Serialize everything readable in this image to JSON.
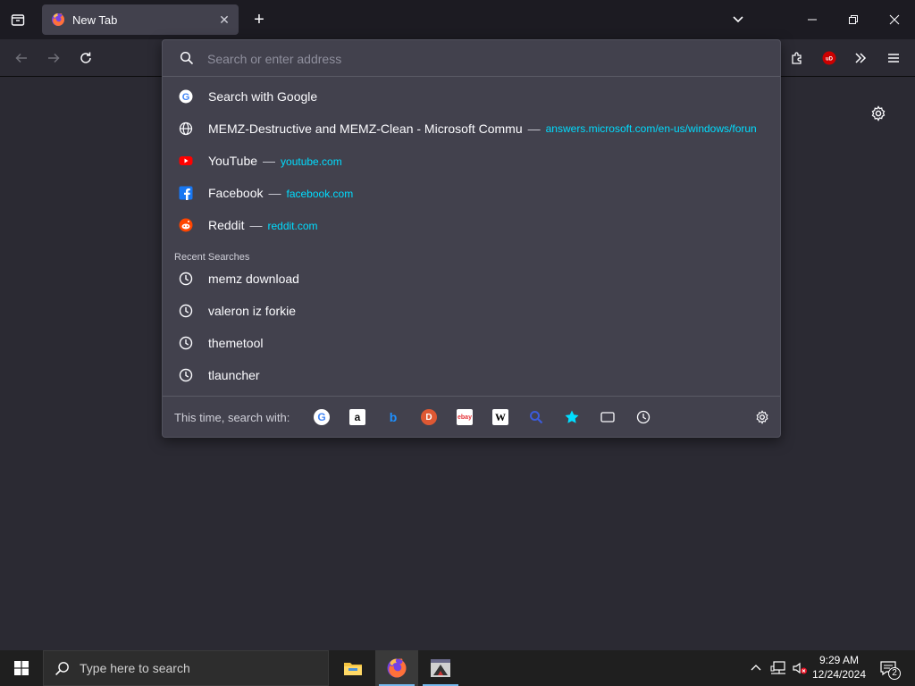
{
  "tab": {
    "title": "New Tab"
  },
  "urlbar": {
    "placeholder": "Search or enter address"
  },
  "suggestions": [
    {
      "title": "Search with Google",
      "sep": "",
      "url": ""
    },
    {
      "title": "MEMZ-Destructive and MEMZ-Clean - Microsoft Commu",
      "sep": "—",
      "url": "answers.microsoft.com/en-us/windows/forun"
    },
    {
      "title": "YouTube",
      "sep": "—",
      "url": "youtube.com"
    },
    {
      "title": "Facebook",
      "sep": "—",
      "url": "facebook.com"
    },
    {
      "title": "Reddit",
      "sep": "—",
      "url": "reddit.com"
    }
  ],
  "recent_label": "Recent Searches",
  "recent": [
    "memz download",
    "valeron iz forkie",
    "themetool",
    "tlauncher"
  ],
  "oneoff_label": "This time, search with:",
  "engines": [
    "google",
    "amazon",
    "bing",
    "duckduckgo",
    "ebay",
    "wikipedia",
    "search",
    "bookmarks",
    "tabs",
    "history"
  ],
  "taskbar": {
    "search_placeholder": "Type here to search",
    "time": "9:29 AM",
    "date": "12/24/2024",
    "notifications": "2"
  },
  "colors": {
    "accent_url": "#00ddff",
    "panel": "#42414d",
    "toolbar": "#2b2a33"
  }
}
